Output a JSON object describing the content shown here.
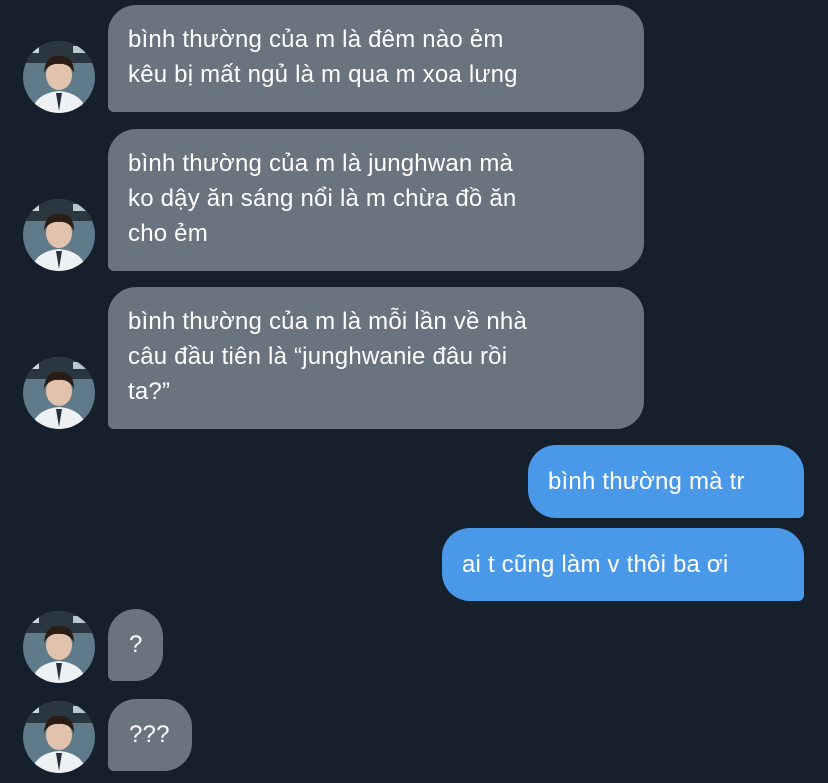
{
  "conversation": {
    "messages": [
      {
        "direction": "incoming",
        "text": "bình thường của m là đêm nào ẻm\nkêu bị mất ngủ là m qua m xoa lưng"
      },
      {
        "direction": "incoming",
        "text": "bình thường của m là junghwan mà\nko dậy ăn sáng nổi là m chừa đồ ăn\ncho ẻm"
      },
      {
        "direction": "incoming",
        "text": "bình thường của m là mỗi lần về nhà\ncâu đầu tiên là “junghwanie đâu rồi\nta?”"
      },
      {
        "direction": "outgoing",
        "text": "bình thường mà tr"
      },
      {
        "direction": "outgoing",
        "text": "ai t cũng làm v thôi ba ơi"
      },
      {
        "direction": "incoming",
        "text": "?"
      },
      {
        "direction": "incoming",
        "text": "???"
      }
    ]
  },
  "avatar_icon": "contact-photo-icon",
  "colors": {
    "background": "#16202c",
    "incoming_bubble": "#69747f",
    "outgoing_bubble": "#4a99e9",
    "text": "#ffffff"
  }
}
